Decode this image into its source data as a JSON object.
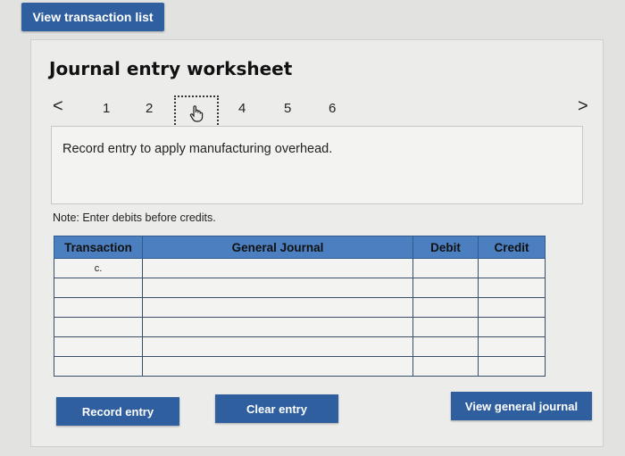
{
  "header": {
    "view_transaction_list_label": "View transaction list"
  },
  "worksheet": {
    "title": "Journal entry worksheet",
    "pager": {
      "prev": "<",
      "next": ">",
      "pages": [
        "1",
        "2",
        "4",
        "5",
        "6"
      ],
      "current_icon": "hand-pointer-icon"
    },
    "instruction": "Record entry to apply manufacturing overhead.",
    "note": "Note: Enter debits before credits.",
    "table": {
      "headers": [
        "Transaction",
        "General Journal",
        "Debit",
        "Credit"
      ],
      "rows": [
        {
          "transaction": "c."
        },
        {
          "transaction": ""
        },
        {
          "transaction": ""
        },
        {
          "transaction": ""
        },
        {
          "transaction": ""
        },
        {
          "transaction": ""
        }
      ]
    },
    "buttons": {
      "record_entry": "Record entry",
      "clear_entry": "Clear entry",
      "view_general_journal": "View general journal"
    }
  },
  "colors": {
    "accent": "#2f5f9e",
    "table_header": "#4b7fc0"
  }
}
